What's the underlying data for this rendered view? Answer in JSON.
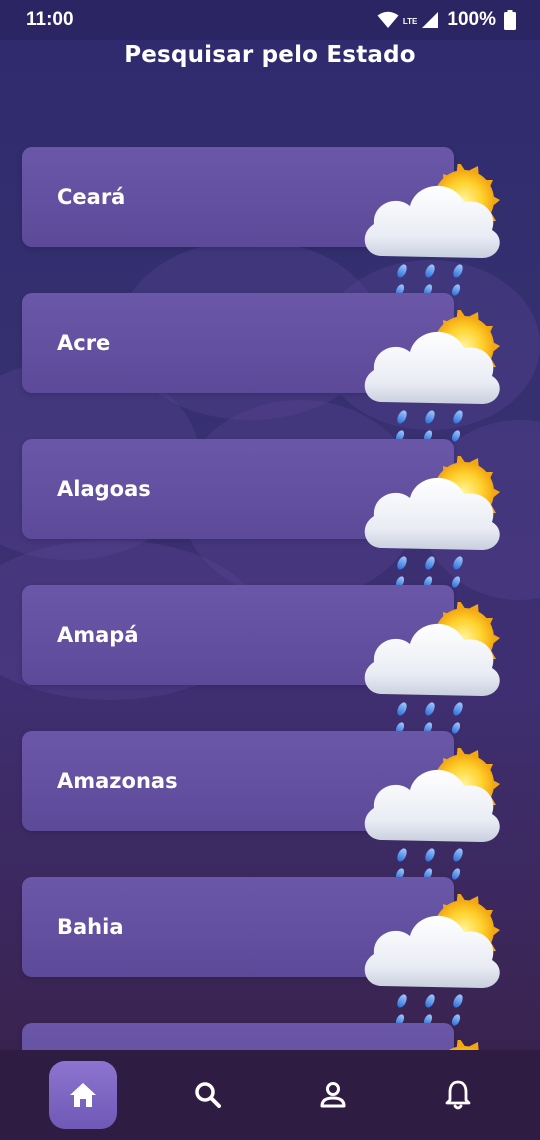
{
  "status_bar": {
    "time": "11:00",
    "network": "LTE",
    "battery": "100%"
  },
  "header": {
    "title": "Pesquisar pelo Estado"
  },
  "states": [
    {
      "name": "Ceará"
    },
    {
      "name": "Acre"
    },
    {
      "name": "Alagoas"
    },
    {
      "name": "Amapá"
    },
    {
      "name": "Amazonas"
    },
    {
      "name": "Bahia"
    },
    {
      "name": ""
    }
  ],
  "weather_icon": "partly-cloudy-rain-icon",
  "bottom_nav": [
    {
      "icon": "home-icon",
      "active": true
    },
    {
      "icon": "search-icon",
      "active": false
    },
    {
      "icon": "profile-icon",
      "active": false
    },
    {
      "icon": "bell-icon",
      "active": false
    }
  ],
  "colors": {
    "accent": "#7b64c2",
    "card": "#6250a0",
    "background": "#33306f",
    "nav": "#2f1c42"
  }
}
